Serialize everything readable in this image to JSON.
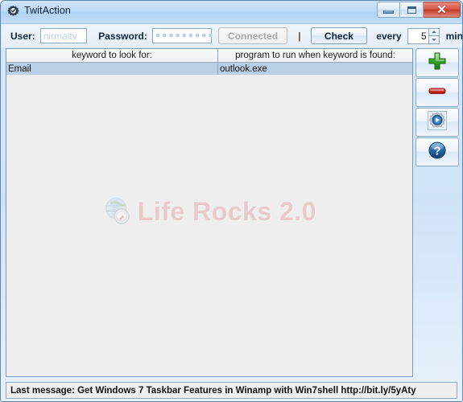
{
  "window": {
    "title": "TwitAction",
    "app_icon": "gear-check-icon",
    "controls": {
      "minimize": "Minimize",
      "maximize": "Maximize",
      "close": "Close",
      "close_glyph": "✕"
    }
  },
  "toolbar": {
    "user_label": "User:",
    "user_value": "nirmaltv",
    "password_label": "Password:",
    "password_value": "●●●●●●●●●",
    "connected_label": "Connected",
    "separator": "|",
    "check_label": "Check",
    "every_label": "every",
    "interval_value": "5",
    "min_label": "min"
  },
  "list": {
    "columns": [
      "keyword to look for:",
      "program to run when keyword is found:"
    ],
    "rows": [
      {
        "keyword": "Email",
        "program": "outlook.exe",
        "selected": true
      }
    ]
  },
  "watermark": {
    "text": "Life Rocks 2.0",
    "icon": "globe-compass-icon",
    "color": "#e09a9f"
  },
  "side_buttons": [
    {
      "name": "add-button",
      "icon": "plus-icon",
      "color": "#2f9b2f"
    },
    {
      "name": "remove-button",
      "icon": "minus-icon",
      "color": "#d42a2a"
    },
    {
      "name": "settings-button",
      "icon": "gear-icon",
      "color": "#2a6ab5"
    },
    {
      "name": "help-button",
      "icon": "question-mark-icon",
      "color": "#1f5fa8"
    }
  ],
  "statusbar": {
    "text": "Last message: Get Windows 7 Taskbar Features in Winamp with Win7shell http://bit.ly/5yAty"
  }
}
